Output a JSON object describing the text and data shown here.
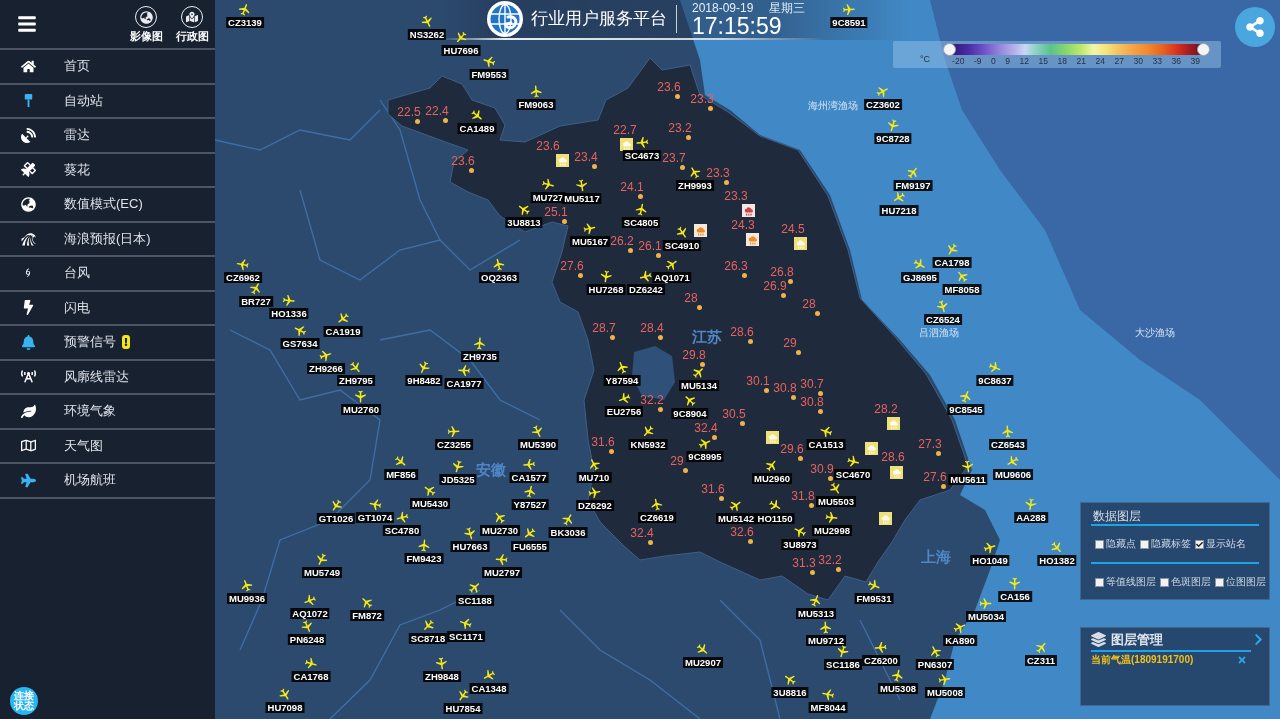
{
  "header": {
    "title": "行业用户服务平台",
    "date": "2018-09-19",
    "weekday": "星期三",
    "time": "17:15:59"
  },
  "sidebar": {
    "view_buttons": [
      {
        "label": "影像图"
      },
      {
        "label": "行政图"
      }
    ],
    "items": [
      {
        "label": "首页",
        "active": false,
        "alert": false
      },
      {
        "label": "自动站",
        "active": true,
        "alert": false
      },
      {
        "label": "雷达",
        "active": false,
        "alert": false
      },
      {
        "label": "葵花",
        "active": false,
        "alert": false
      },
      {
        "label": "数值模式(EC)",
        "active": false,
        "alert": false
      },
      {
        "label": "海浪预报(日本)",
        "active": false,
        "alert": false
      },
      {
        "label": "台风",
        "active": false,
        "alert": false
      },
      {
        "label": "闪电",
        "active": false,
        "alert": false
      },
      {
        "label": "预警信号",
        "active": true,
        "alert": true
      },
      {
        "label": "风廓线雷达",
        "active": false,
        "alert": false
      },
      {
        "label": "环境气象",
        "active": false,
        "alert": false
      },
      {
        "label": "天气图",
        "active": false,
        "alert": false
      },
      {
        "label": "机场航班",
        "active": true,
        "alert": false
      }
    ],
    "connection_badge": "连接状态"
  },
  "legend": {
    "unit": "°C",
    "ticks": [
      "-20",
      "-9",
      "0",
      "9",
      "12",
      "15",
      "18",
      "21",
      "24",
      "27",
      "30",
      "33",
      "36",
      "39"
    ],
    "handles": [
      {
        "level": 0
      },
      {
        "level": 1
      }
    ]
  },
  "map": {
    "region_labels": [
      {
        "text": "海州湾渔场",
        "kind": "sea_area"
      },
      {
        "text": "江苏",
        "kind": "province"
      },
      {
        "text": "吕泗渔场",
        "kind": "sea_area"
      },
      {
        "text": "大沙渔场",
        "kind": "sea_area"
      },
      {
        "text": "安徽",
        "kind": "province"
      },
      {
        "text": "上海",
        "kind": "province"
      }
    ],
    "temperatures": [
      "23.6",
      "23.3",
      "22.5",
      "22.4",
      "22.7",
      "23.2",
      "23.6",
      "23.6",
      "23.4",
      "23.7",
      "23.3",
      "24.1",
      "23.3",
      "25.1",
      "24.3",
      "24.5",
      "26.2",
      "26.1",
      "27.6",
      "26.3",
      "26.8",
      "26.9",
      "28",
      "28",
      "28.7",
      "28.4",
      "28.6",
      "29",
      "29.8",
      "30.1",
      "30.8",
      "30.7",
      "32.2",
      "30.8",
      "30.5",
      "28.2",
      "32.4",
      "31.6",
      "29.6",
      "27.3",
      "29",
      "28.6",
      "30.9",
      "27.6",
      "31.6",
      "31.8",
      "32.4",
      "32.6",
      "31.3",
      "32.2"
    ],
    "flights": [
      "CZ3139",
      "9C8591",
      "NS3262",
      "HU7696",
      "FM9553",
      "FM9063",
      "CZ3602",
      "CA1489",
      "9C8728",
      "SC4673",
      "ZH9993",
      "FM9197",
      "MU727",
      "MU5117",
      "HU7218",
      "3U8813",
      "SC4805",
      "MU5167",
      "SC4910",
      "CA1798",
      "CZ6962",
      "OQ2363",
      "AQ1071",
      "GJ8695",
      "HU7268",
      "DZ6242",
      "MF8058",
      "BR727",
      "HO1336",
      "CZ6524",
      "CA1919",
      "GS7634",
      "ZH9735",
      "ZH9266",
      "ZH9795",
      "9H8482",
      "CA1977",
      "Y87594",
      "MU5134",
      "9C8637",
      "MU2760",
      "EU2756",
      "9C8904",
      "9C8545",
      "CZ3255",
      "MU5390",
      "KN5932",
      "CA1513",
      "CZ6543",
      "9C8995",
      "MF856",
      "JD5325",
      "CA1577",
      "MU710",
      "MU2960",
      "SC4670",
      "MU5611",
      "MU9606",
      "MU5430",
      "Y87527",
      "DZ6292",
      "MU5503",
      "GT1026",
      "GT1074",
      "CZ6619",
      "MU5142",
      "HO1150",
      "AA288",
      "SC4780",
      "MU2730",
      "BK3036",
      "MU2998",
      "HU7663",
      "FU6555",
      "3U8973",
      "FM9423",
      "HO1049",
      "HO1382",
      "MU5749",
      "MU2797",
      "MU9936",
      "SC1188",
      "FM9531",
      "CA156",
      "AQ1072",
      "FM872",
      "MU5313",
      "MU5034",
      "PN6248",
      "SC8718",
      "SC1171",
      "MU9712",
      "KA890",
      "MU2907",
      "SC1186",
      "CZ6200",
      "PN6307",
      "CZ311",
      "CA1768",
      "ZH9848",
      "CA1348",
      "3U8816",
      "MU5308",
      "MU5008",
      "HU7098",
      "HU7854",
      "MF8044"
    ]
  },
  "data_layers": {
    "title": "数据图层",
    "options": [
      {
        "label": "隐藏点",
        "checked": false
      },
      {
        "label": "隐藏标签",
        "checked": false
      },
      {
        "label": "显示站名",
        "checked": true
      }
    ],
    "layers": [
      {
        "label": "等值线图层",
        "checked": false
      },
      {
        "label": "色斑图层",
        "checked": false
      },
      {
        "label": "位图图层",
        "checked": false
      }
    ]
  },
  "layer_manager": {
    "title": "图层管理",
    "layers": [
      {
        "label": "当前气温(1809191700)"
      }
    ]
  }
}
